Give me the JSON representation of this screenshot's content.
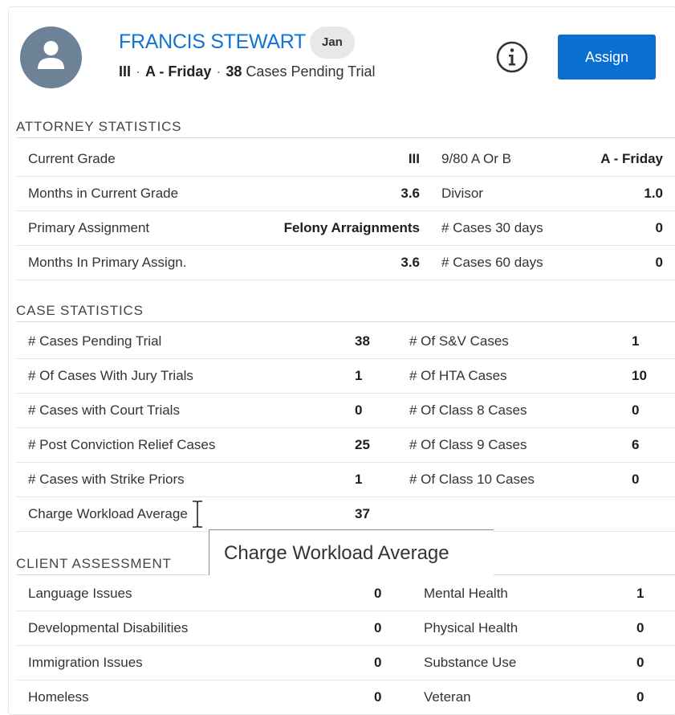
{
  "header": {
    "name": "FRANCIS STEWART",
    "tag": "Jan",
    "grade": "III",
    "schedule": "A - Friday",
    "pending_count": "38",
    "pending_label": "Cases Pending Trial",
    "assign_label": "Assign",
    "icons": {
      "avatar": "user-avatar-icon",
      "info": "info-icon"
    }
  },
  "attorney": {
    "title": "ATTORNEY STATISTICS",
    "rows": [
      {
        "label": "Current Grade",
        "value": "III",
        "label2": "9/80 A Or B",
        "value2": "A - Friday"
      },
      {
        "label": "Months in Current Grade",
        "value": "3.6",
        "label2": "Divisor",
        "value2": "1.0"
      },
      {
        "label": "Primary Assignment",
        "value": "Felony Arraignments",
        "label2": "# Cases 30 days",
        "value2": "0"
      },
      {
        "label": "Months In Primary Assign.",
        "value": "3.6",
        "label2": "# Cases 60 days",
        "value2": "0"
      }
    ]
  },
  "cases": {
    "title": "CASE STATISTICS",
    "rows": [
      {
        "label": "# Cases Pending Trial",
        "value": "38",
        "label2": "# Of S&V Cases",
        "value2": "1"
      },
      {
        "label": "# Of Cases With Jury Trials",
        "value": "1",
        "label2": "# Of HTA Cases",
        "value2": "10"
      },
      {
        "label": "# Cases with Court Trials",
        "value": "0",
        "label2": "# Of Class 8 Cases",
        "value2": "0"
      },
      {
        "label": "# Post Conviction Relief Cases",
        "value": "25",
        "label2": "# Of Class 9 Cases",
        "value2": "6"
      },
      {
        "label": "# Cases with Strike Priors",
        "value": "1",
        "label2": "# Of Class 10 Cases",
        "value2": "0"
      },
      {
        "label": "Charge Workload Average",
        "value": "37"
      }
    ]
  },
  "client": {
    "title": "CLIENT ASSESSMENT",
    "rows": [
      {
        "label": "Language Issues",
        "value": "0",
        "label2": "Mental Health",
        "value2": "1"
      },
      {
        "label": "Developmental Disabilities",
        "value": "0",
        "label2": "Physical Health",
        "value2": "0"
      },
      {
        "label": "Immigration Issues",
        "value": "0",
        "label2": "Substance Use",
        "value2": "0"
      },
      {
        "label": "Homeless",
        "value": "0",
        "label2": "Veteran",
        "value2": "0"
      }
    ]
  },
  "tooltip": {
    "text": "Charge Workload Average"
  },
  "colors": {
    "accent": "#1173d4",
    "button": "#0b6fd1",
    "avatar": "#6e8297"
  }
}
